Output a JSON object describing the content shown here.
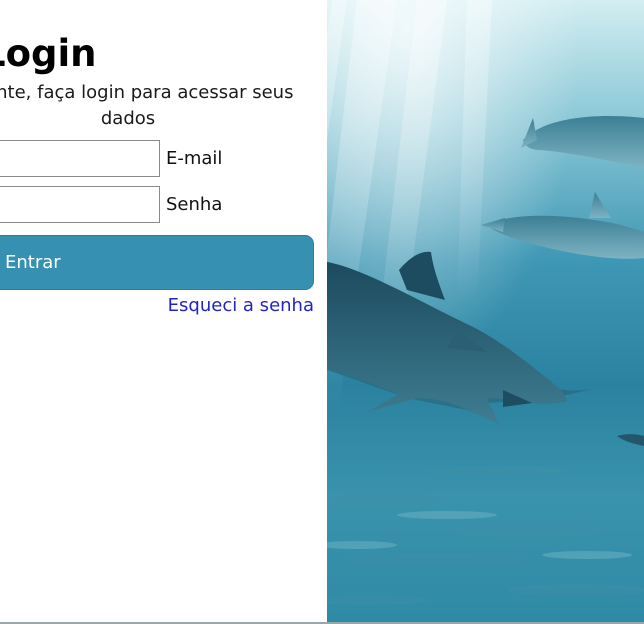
{
  "login": {
    "title": "Login",
    "subtitle": "Cliente, faça login para acessar seus dados",
    "email_label": "E-mail",
    "email_value": "",
    "password_label": "Senha",
    "password_value": "",
    "submit_label": "Entrar",
    "forgot_label": "Esqueci a senha"
  },
  "hero_image": {
    "subject": "dolphins-underwater-photo"
  },
  "colors": {
    "button": "#3590b2",
    "link": "#2323c8",
    "water_light": "#cfe9ef",
    "water_deep": "#14566e"
  }
}
